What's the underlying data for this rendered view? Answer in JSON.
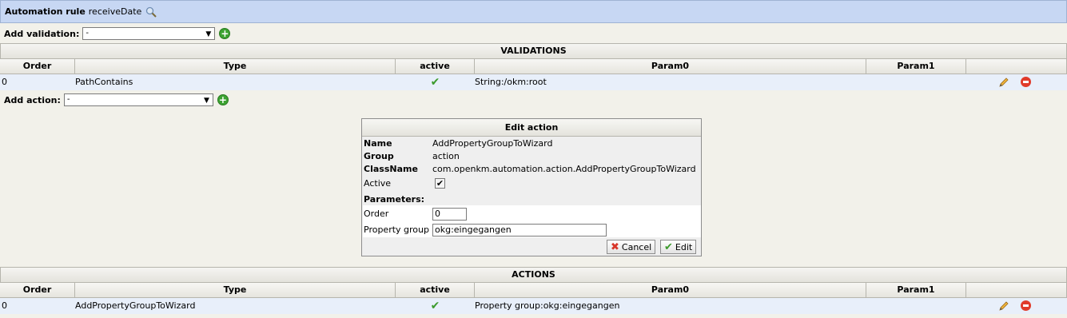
{
  "header": {
    "label": "Automation rule",
    "name": "receiveDate",
    "icon": "magnifier-icon"
  },
  "add_validation": {
    "label": "Add validation:",
    "selected": "-"
  },
  "validations": {
    "title": "VALIDATIONS",
    "columns": [
      "Order",
      "Type",
      "active",
      "Param0",
      "Param1"
    ],
    "rows": [
      {
        "order": "0",
        "type": "PathContains",
        "param0": "String:/okm:root",
        "param1": ""
      }
    ]
  },
  "add_action": {
    "label": "Add action:",
    "selected": "-"
  },
  "edit_dialog": {
    "title": "Edit action",
    "name_label": "Name",
    "name_value": "AddPropertyGroupToWizard",
    "group_label": "Group",
    "group_value": "action",
    "classname_label": "ClassName",
    "classname_value": "com.openkm.automation.action.AddPropertyGroupToWizard",
    "active_label": "Active",
    "params_label": "Parameters:",
    "order_label": "Order",
    "order_value": "0",
    "property_group_label": "Property group",
    "property_group_value": "okg:eingegangen",
    "cancel_label": "Cancel",
    "edit_label": "Edit"
  },
  "actions": {
    "title": "ACTIONS",
    "columns": [
      "Order",
      "Type",
      "active",
      "Param0",
      "Param1"
    ],
    "rows": [
      {
        "order": "0",
        "type": "AddPropertyGroupToWizard",
        "param0": "Property group:okg:eingegangen",
        "param1": ""
      }
    ]
  },
  "colors": {
    "header_bg": "#c7d7f3",
    "row_bg": "#e8effa",
    "check": "#3c9b2c",
    "delete": "#e03b2b"
  }
}
